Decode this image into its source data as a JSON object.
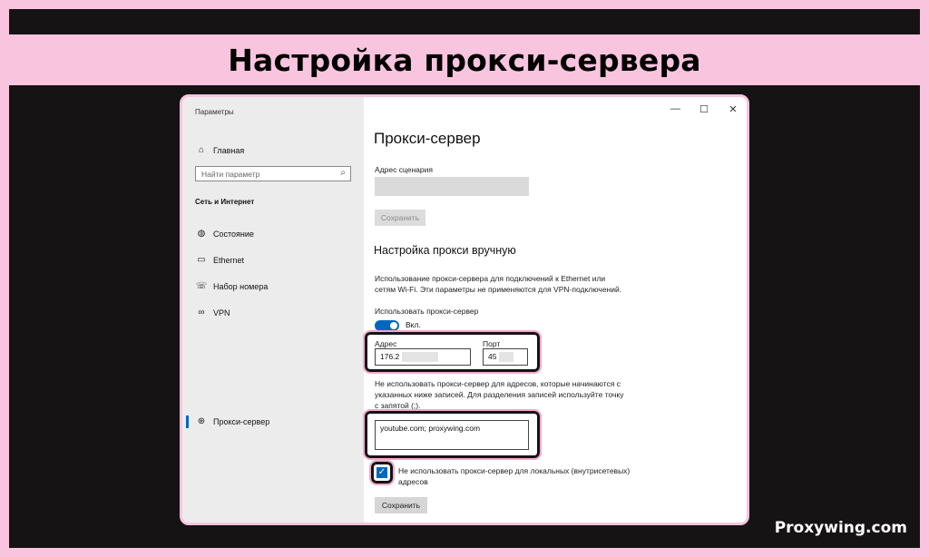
{
  "banner": {
    "title": "Настройка прокси-сервера",
    "watermark": "Proxywing.com"
  },
  "window": {
    "title": "Параметры",
    "controls": {
      "minimize": "—",
      "maximize": "☐",
      "close": "✕"
    }
  },
  "sidebar": {
    "home": "Главная",
    "search_placeholder": "Найти параметр",
    "section": "Сеть и Интернет",
    "items": [
      {
        "label": "Состояние",
        "icon": "globe-status-icon"
      },
      {
        "label": "Ethernet",
        "icon": "ethernet-icon"
      },
      {
        "label": "Набор номера",
        "icon": "dialup-icon"
      },
      {
        "label": "VPN",
        "icon": "vpn-icon"
      },
      {
        "label": "Прокси-сервер",
        "icon": "globe-icon"
      }
    ]
  },
  "content": {
    "page_title": "Прокси-сервер",
    "script_address_label": "Адрес сценария",
    "save_disabled": "Сохранить",
    "manual_heading": "Настройка прокси вручную",
    "manual_desc_1": "Использование прокси-сервера для подключений к Ethernet или",
    "manual_desc_2": "сетям Wi-Fi. Эти параметры не применяются для VPN-подключений.",
    "use_proxy_label": "Использовать прокси-сервер",
    "toggle_state": "Вкл.",
    "address_label": "Адрес",
    "address_value": "176.2",
    "port_label": "Порт",
    "port_value": "45",
    "exclusions_desc_1": "Не использовать прокси-сервер для адресов, которые начинаются с",
    "exclusions_desc_2": "указанных ниже записей. Для разделения записей используйте точку",
    "exclusions_desc_3": "с запятой (;).",
    "exclusions_value": "youtube.com; proxywing.com",
    "local_bypass_1": "Не использовать прокси-сервер для локальных (внутрисетевых)",
    "local_bypass_2": "адресов",
    "save_button": "Сохранить"
  }
}
